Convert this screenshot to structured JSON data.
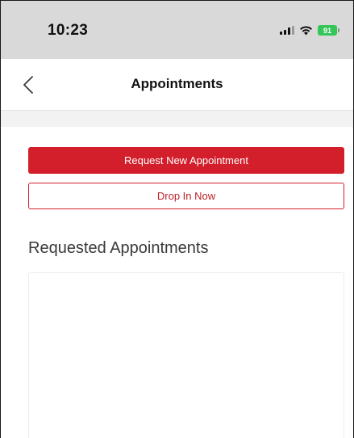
{
  "status_bar": {
    "time": "10:23",
    "battery": "91",
    "icons": [
      "signal-icon",
      "wifi-icon",
      "battery-icon"
    ]
  },
  "nav": {
    "back_icon": "chevron-left-icon",
    "title": "Appointments"
  },
  "actions": {
    "request_label": "Request New Appointment",
    "drop_in_label": "Drop In Now"
  },
  "requested": {
    "heading": "Requested Appointments",
    "items": []
  },
  "colors": {
    "accent": "#d21f2b",
    "status_bar_bg": "#d9d9d9",
    "battery_green": "#35c659"
  }
}
